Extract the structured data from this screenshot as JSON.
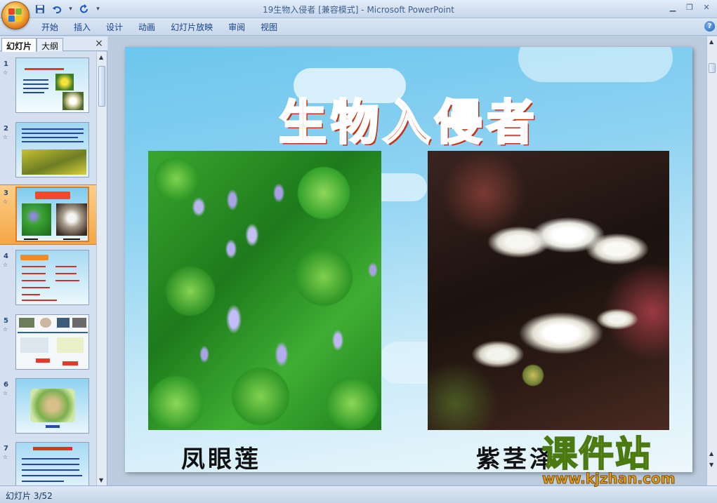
{
  "window": {
    "title_doc": "19生物入侵者 [兼容模式]",
    "title_sep": " - ",
    "title_app": "Microsoft PowerPoint"
  },
  "quick_access": {
    "save_icon": "save-icon",
    "undo_icon": "undo-icon",
    "redo_icon": "redo-icon"
  },
  "ribbon": {
    "tabs": [
      "开始",
      "插入",
      "设计",
      "动画",
      "幻灯片放映",
      "审阅",
      "视图"
    ],
    "help_label": "?"
  },
  "left_pane": {
    "tabs": [
      "幻灯片",
      "大纲"
    ],
    "close_label": "×",
    "thumbnails": [
      {
        "number": "1",
        "star": "☆"
      },
      {
        "number": "2",
        "star": "☆"
      },
      {
        "number": "3",
        "star": "☆",
        "selected": true
      },
      {
        "number": "4",
        "star": "☆"
      },
      {
        "number": "5",
        "star": "☆"
      },
      {
        "number": "6",
        "star": "☆"
      },
      {
        "number": "7",
        "star": "☆"
      }
    ]
  },
  "slide": {
    "title": "生物入侵者",
    "left_caption": "凤眼莲",
    "right_caption": "紫茎泽"
  },
  "watermark": {
    "top": "课件站",
    "bottom": "www.kjzhan.com"
  },
  "status": {
    "slide_indicator": "幻灯片 3/52"
  },
  "colors": {
    "title_red": "#f2492a",
    "selected_thumb": "#f4a646",
    "ribbon_text": "#15428b"
  }
}
